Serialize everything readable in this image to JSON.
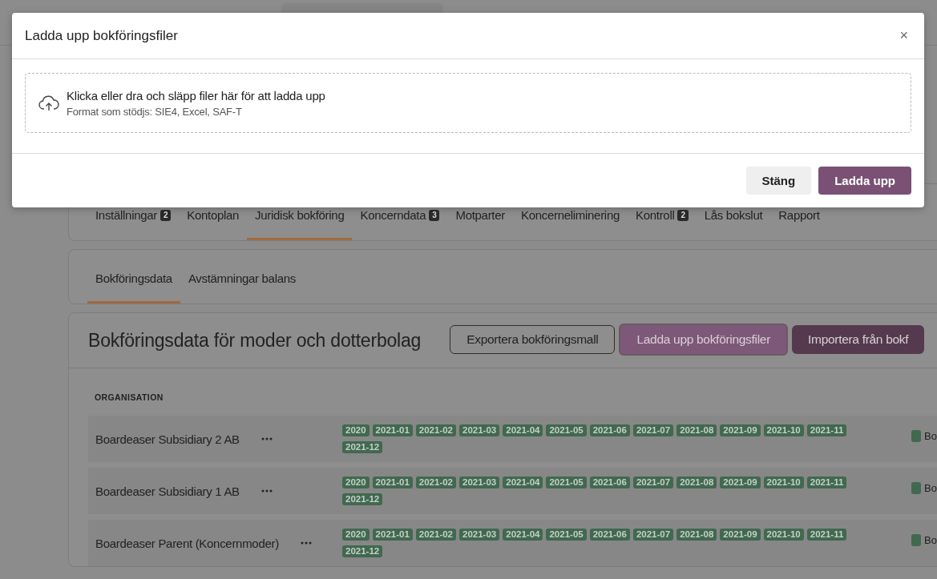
{
  "tabs": [
    {
      "label": "Inställningar",
      "badge": "2",
      "selected": false
    },
    {
      "label": "Kontoplan",
      "selected": false
    },
    {
      "label": "Juridisk bokföring",
      "selected": true
    },
    {
      "label": "Koncerndata",
      "badge": "3",
      "selected": false
    },
    {
      "label": "Motparter",
      "selected": false
    },
    {
      "label": "Koncerneliminering",
      "selected": false
    },
    {
      "label": "Kontroll",
      "badge": "2",
      "selected": false
    },
    {
      "label": "Lås bokslut",
      "selected": false
    },
    {
      "label": "Rapport",
      "selected": false
    }
  ],
  "subtabs": [
    {
      "label": "Bokföringsdata",
      "selected": true
    },
    {
      "label": "Avstämningar balans",
      "selected": false
    }
  ],
  "panel": {
    "title": "Bokföringsdata för moder och dotterbolag",
    "buttons": [
      {
        "label": "Exportera bokföringsmall",
        "kind": "outline"
      },
      {
        "label": "Ladda upp bokföringsfiler",
        "kind": "focused"
      },
      {
        "label": "Importera från bokf",
        "kind": "primary"
      }
    ],
    "column_header": "ORGANISATION",
    "rows": [
      {
        "name": "Boardeaser Subsidiary 2 AB",
        "periods": [
          "2020",
          "2021-01",
          "2021-02",
          "2021-03",
          "2021-04",
          "2021-05",
          "2021-06",
          "2021-07",
          "2021-08",
          "2021-09",
          "2021-10",
          "2021-11",
          "2021-12"
        ],
        "status": "Bo"
      },
      {
        "name": "Boardeaser Subsidiary 1 AB",
        "periods": [
          "2020",
          "2021-01",
          "2021-02",
          "2021-03",
          "2021-04",
          "2021-05",
          "2021-06",
          "2021-07",
          "2021-08",
          "2021-09",
          "2021-10",
          "2021-11",
          "2021-12"
        ],
        "status": "Bo"
      },
      {
        "name": "Boardeaser Parent (Koncernmoder)",
        "periods": [
          "2020",
          "2021-01",
          "2021-02",
          "2021-03",
          "2021-04",
          "2021-05",
          "2021-06",
          "2021-07",
          "2021-08",
          "2021-09",
          "2021-10",
          "2021-11",
          "2021-12"
        ],
        "status": "Bo"
      }
    ]
  },
  "modal": {
    "title": "Ladda upp bokföringsfiler",
    "close": "×",
    "dropzone": {
      "text": "Klicka eller dra och släpp filer här för att ladda upp",
      "hint": "Format som stödjs: SIE4, Excel, SAF-T"
    },
    "buttons": [
      {
        "label": "Stäng",
        "kind": "secondary"
      },
      {
        "label": "Ladda upp",
        "kind": "primary"
      }
    ]
  }
}
